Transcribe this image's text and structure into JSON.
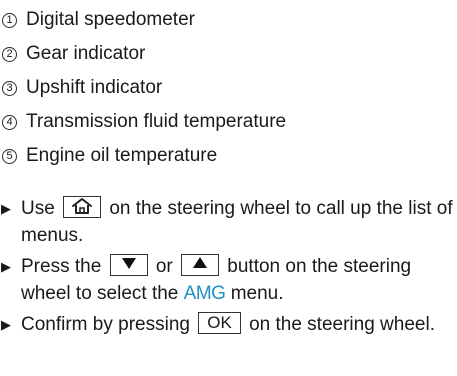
{
  "legend": [
    {
      "num": "1",
      "label": "Digital speedometer"
    },
    {
      "num": "2",
      "label": "Gear indicator"
    },
    {
      "num": "3",
      "label": "Upshift indicator"
    },
    {
      "num": "4",
      "label": "Transmission fluid temperature"
    },
    {
      "num": "5",
      "label": "Engine oil temperature"
    }
  ],
  "steps": {
    "bullet": "▶",
    "step1": {
      "pre": "Use",
      "key_icon": "home-icon",
      "post": "on the steering wheel to call up the list of menus."
    },
    "step2": {
      "pre": "Press the",
      "key1_icon": "down-triangle-icon",
      "mid": "or",
      "key2_icon": "up-triangle-icon",
      "post1": "button on the steering wheel to select the",
      "highlight": "AMG",
      "post2": "menu."
    },
    "step3": {
      "pre": "Confirm by pressing",
      "key_label": "OK",
      "post": "on the steering wheel."
    }
  },
  "colors": {
    "text": "#1a1a1a",
    "accent": "#1f8fc9"
  }
}
